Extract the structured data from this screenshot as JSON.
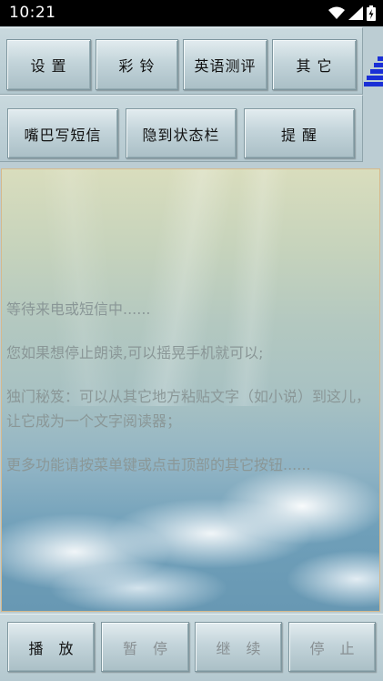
{
  "status_bar": {
    "time": "10:21",
    "icons": [
      "wifi-icon",
      "signal-icon",
      "battery-charging-icon"
    ]
  },
  "top_buttons": {
    "settings": "设 置",
    "ringtone": "彩 铃",
    "english_test": "英语测评",
    "other": "其 它"
  },
  "second_row": {
    "voice_sms": "嘴巴写短信",
    "hide_statusbar": "隐到状态栏",
    "remind": "提 醒"
  },
  "content": {
    "line1": "等待来电或短信中......",
    "line2": "您如果想停止朗读,可以摇晃手机就可以;",
    "line3": "独门秘笈：可以从其它地方粘贴文字（如小说）到这儿，让它成为一个文字阅读器；",
    "line4": "更多功能请按菜单键或点击顶部的其它按钮......"
  },
  "bottom_buttons": {
    "play": "播 放",
    "pause": "暂 停",
    "resume": "继 续",
    "stop": "停 止"
  },
  "colors": {
    "accent_blue": "#1a2fd6",
    "text_gray": "#8a9797",
    "disabled_label": "#888f92"
  }
}
